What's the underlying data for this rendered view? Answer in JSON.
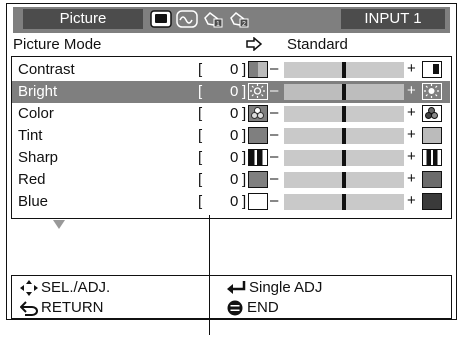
{
  "header": {
    "tab_label": "Picture",
    "icons": [
      "picture-tab-icon",
      "audio-tab-icon",
      "setup1-tab-icon",
      "setup2-tab-icon"
    ],
    "input_label": "INPUT 1"
  },
  "picture_mode": {
    "label": "Picture Mode",
    "value": "Standard"
  },
  "rows": [
    {
      "label": "Contrast",
      "lbracket": "[",
      "value": "0",
      "rbracket": "]"
    },
    {
      "label": "Bright",
      "lbracket": "[",
      "value": "0",
      "rbracket": "]"
    },
    {
      "label": "Color",
      "lbracket": "[",
      "value": "0",
      "rbracket": "]"
    },
    {
      "label": "Tint",
      "lbracket": "[",
      "value": "0",
      "rbracket": "]"
    },
    {
      "label": "Sharp",
      "lbracket": "[",
      "value": "0",
      "rbracket": "]"
    },
    {
      "label": "Red",
      "lbracket": "[",
      "value": "0",
      "rbracket": "]"
    },
    {
      "label": "Blue",
      "lbracket": "[",
      "value": "0",
      "rbracket": "]"
    }
  ],
  "footer": {
    "sel_adj": "SEL./ADJ.",
    "return": "RETURN",
    "single_adj": "Single ADJ",
    "end": "END"
  },
  "colors": {
    "header_bg": "#7f7f7f",
    "tab_bg": "#4c4c4c",
    "selected_row": "#7f7f7f",
    "bar": "#c9c9c9"
  }
}
